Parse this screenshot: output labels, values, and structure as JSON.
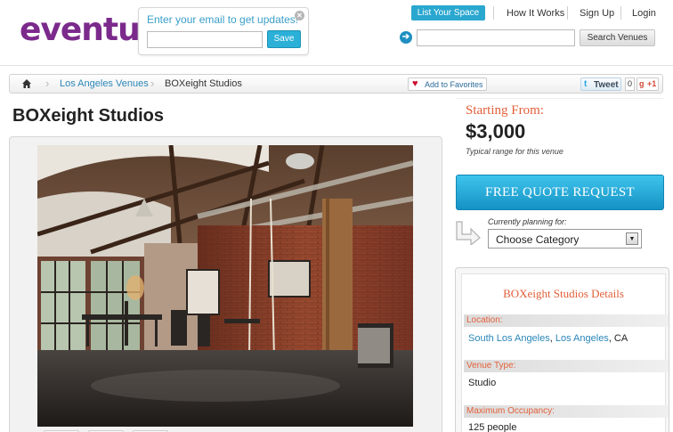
{
  "header": {
    "logo": "eventup",
    "subscribe": {
      "title": "Enter your email to get updates!",
      "email_placeholder": "",
      "save_label": "Save"
    },
    "nav": {
      "list_space": "List Your Space",
      "how_it_works": "How It Works",
      "sign_up": "Sign Up",
      "login": "Login"
    },
    "search": {
      "value": "",
      "button_label": "Search Venues"
    }
  },
  "breadcrumb": {
    "items": [
      "Los Angeles Venues",
      "BOXeight Studios"
    ],
    "favorites_label": "Add to Favorites",
    "tweet_label": "Tweet",
    "tweet_count": "0",
    "gplus_label": "+1"
  },
  "venue": {
    "title": "BOXeight Studios"
  },
  "pricing": {
    "label": "Starting From:",
    "value": "$3,000",
    "note": "Typical range for this venue"
  },
  "quote": {
    "button_label": "FREE QUOTE REQUEST",
    "planning_label": "Currently planning for:",
    "category_value": "Choose Category"
  },
  "details": {
    "title": "BOXeight Studios Details",
    "location_label": "Location:",
    "location_area": "South Los Angeles",
    "location_sep": ",",
    "location_city": "Los Angeles",
    "location_state": ", CA",
    "type_label": "Venue Type:",
    "type_value": "Studio",
    "occupancy_label": "Maximum Occupancy:",
    "occupancy_value": "125 people"
  },
  "colors": {
    "brand_purple": "#7b2a8c",
    "accent_blue": "#2aa7cf",
    "accent_orange": "#e2603a"
  }
}
